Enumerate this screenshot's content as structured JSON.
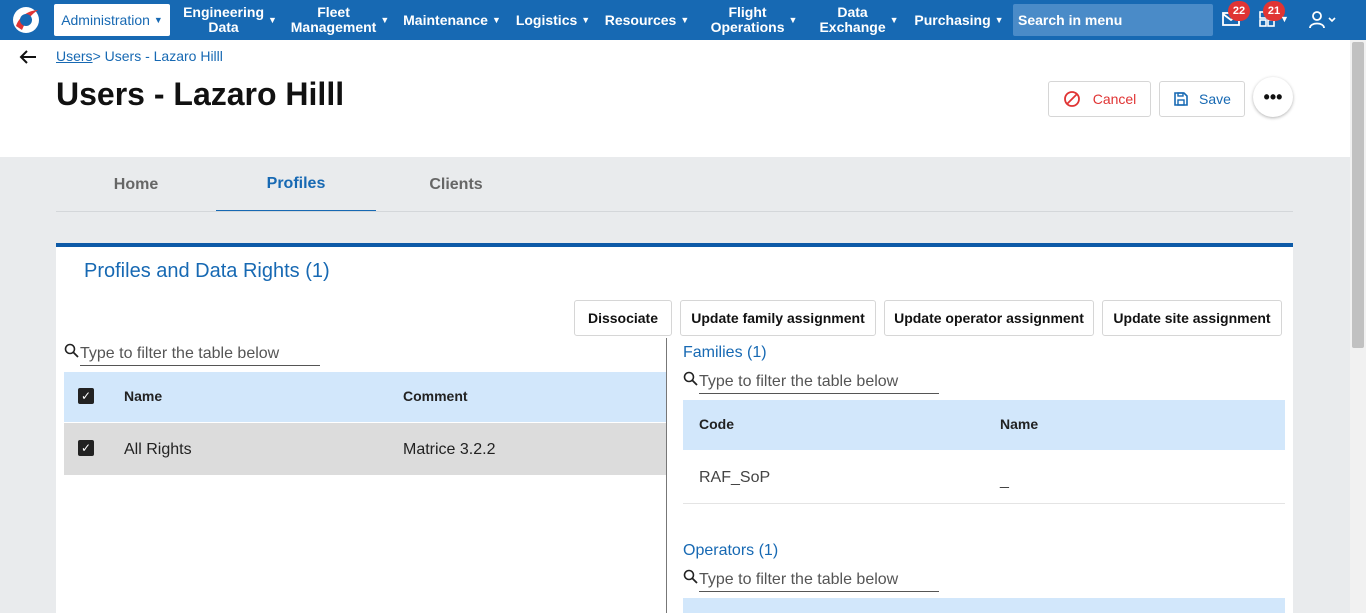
{
  "nav": {
    "active_item": "Administration",
    "items": [
      {
        "label": "Engineering\nData"
      },
      {
        "label": "Fleet\nManagement"
      },
      {
        "label": "Maintenance"
      },
      {
        "label": "Logistics"
      },
      {
        "label": "Resources"
      },
      {
        "label": "Flight\nOperations"
      },
      {
        "label": "Data\nExchange"
      },
      {
        "label": "Purchasing"
      }
    ],
    "search_label": "Search in menu",
    "mail_count": "22",
    "tasks_count": "21"
  },
  "breadcrumb": {
    "parent": "Users",
    "separator": ">",
    "current": "Users - Lazaro Hilll"
  },
  "page": {
    "title": "Users - Lazaro Hilll"
  },
  "actions": {
    "cancel": "Cancel",
    "save": "Save",
    "more": "•••"
  },
  "tabs": [
    {
      "label": "Home"
    },
    {
      "label": "Profiles"
    },
    {
      "label": "Clients"
    }
  ],
  "card": {
    "title": "Profiles and Data Rights (1)",
    "buttons": {
      "dissociate": "Dissociate",
      "family": "Update family assignment",
      "operator": "Update operator assignment",
      "site": "Update site assignment"
    },
    "filter_placeholder": "Type to filter the table below",
    "profiles": {
      "columns": {
        "name": "Name",
        "comment": "Comment"
      },
      "rows": [
        {
          "name": "All Rights",
          "comment": "Matrice 3.2.2"
        }
      ]
    },
    "families": {
      "title": "Families (1)",
      "columns": {
        "code": "Code",
        "name": "Name"
      },
      "rows": [
        {
          "code": "RAF_SoP",
          "name": "_"
        }
      ]
    },
    "operators": {
      "title": "Operators (1)"
    }
  },
  "colors": {
    "brand": "#1769b3",
    "cancel": "#e03434",
    "header_row": "#d2e7fb",
    "badge": "#e03434"
  }
}
